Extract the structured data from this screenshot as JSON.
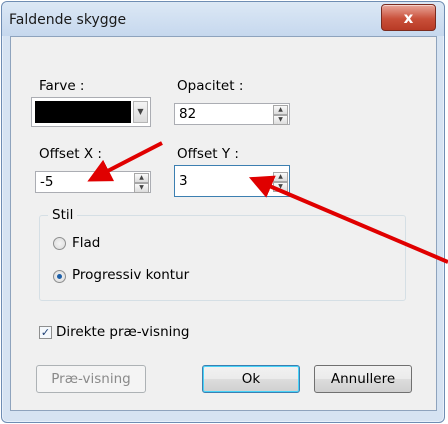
{
  "window": {
    "title": "Faldende skygge",
    "close_symbol": "x"
  },
  "color": {
    "label": "Farve :",
    "value": "#000000"
  },
  "opacity": {
    "label": "Opacitet :",
    "value": "82"
  },
  "offset_x": {
    "label": "Offset X :",
    "value": "-5"
  },
  "offset_y": {
    "label": "Offset Y :",
    "value": "3"
  },
  "style": {
    "legend": "Stil",
    "options": [
      {
        "label": "Flad",
        "selected": false
      },
      {
        "label": "Progressiv kontur",
        "selected": true
      }
    ]
  },
  "preview_checkbox": {
    "label": "Direkte præ-visning",
    "checked": true
  },
  "buttons": {
    "preview": "Præ-visning",
    "ok": "Ok",
    "cancel": "Annullere"
  },
  "annotation_color": "#e00000"
}
